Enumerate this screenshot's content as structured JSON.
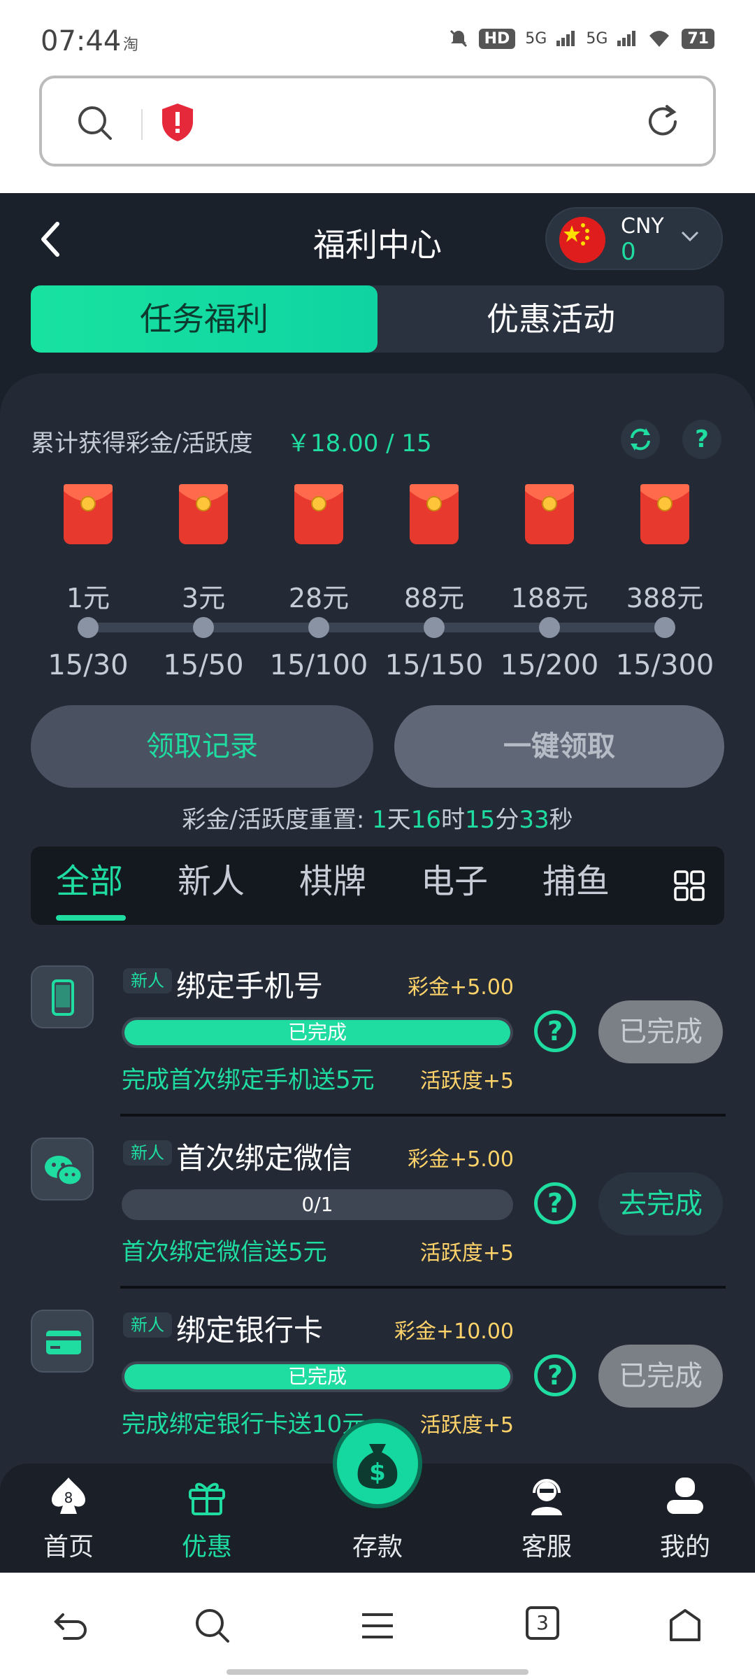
{
  "status_bar": {
    "time": "07:44",
    "app_indicator": "淘",
    "signal_1": "5G",
    "signal_2": "5G",
    "battery": "71",
    "hd": "HD"
  },
  "browser": {
    "search_icon": "search-icon",
    "security_icon": "shield-icon",
    "reload_icon": "reload-icon"
  },
  "header": {
    "title": "福利中心",
    "back_icon": "chevron-left-icon",
    "currency_code": "CNY",
    "balance": "0"
  },
  "top_tabs": [
    {
      "label": "任务福利",
      "active": true
    },
    {
      "label": "优惠活动",
      "active": false
    }
  ],
  "summary": {
    "label": "累计获得彩金/活跃度",
    "value": "￥18.00 / 15"
  },
  "milestones": [
    {
      "amount": "1元",
      "progress": "15/30"
    },
    {
      "amount": "3元",
      "progress": "15/50"
    },
    {
      "amount": "28元",
      "progress": "15/100"
    },
    {
      "amount": "88元",
      "progress": "15/150"
    },
    {
      "amount": "188元",
      "progress": "15/200"
    },
    {
      "amount": "388元",
      "progress": "15/300"
    }
  ],
  "actions": {
    "record": "领取记录",
    "claim_all": "一键领取"
  },
  "reset": {
    "label": "彩金/活跃度重置: ",
    "days": "1",
    "days_unit": "天",
    "hours": "16",
    "hours_unit": "时",
    "minutes": "15",
    "minutes_unit": "分",
    "seconds": "33",
    "seconds_unit": "秒"
  },
  "categories": [
    {
      "label": "全部",
      "active": true
    },
    {
      "label": "新人",
      "active": false
    },
    {
      "label": "棋牌",
      "active": false
    },
    {
      "label": "电子",
      "active": false
    },
    {
      "label": "捕鱼",
      "active": false
    }
  ],
  "tasks": [
    {
      "tag": "新人",
      "title": "绑定手机号",
      "reward": "彩金+5.00",
      "progress_text": "已完成",
      "progress": 1.0,
      "desc": "完成首次绑定手机送5元",
      "activity": "活跃度+5",
      "button": "已完成",
      "icon": "phone-icon"
    },
    {
      "tag": "新人",
      "title": "首次绑定微信",
      "reward": "彩金+5.00",
      "progress_text": "0/1",
      "progress": 0.0,
      "desc": "首次绑定微信送5元",
      "activity": "活跃度+5",
      "button": "去完成",
      "icon": "wechat-icon"
    },
    {
      "tag": "新人",
      "title": "绑定银行卡",
      "reward": "彩金+10.00",
      "progress_text": "已完成",
      "progress": 1.0,
      "desc": "完成绑定银行卡送10元",
      "activity": "活跃度+5",
      "button": "已完成",
      "icon": "bank-card-icon"
    }
  ],
  "bottom_nav": [
    {
      "label": "首页",
      "icon": "home-spade-icon",
      "active": false
    },
    {
      "label": "优惠",
      "icon": "gift-icon",
      "active": true
    },
    {
      "label": "存款",
      "icon": "money-bag-icon",
      "active": false
    },
    {
      "label": "客服",
      "icon": "support-agent-icon",
      "active": false
    },
    {
      "label": "我的",
      "icon": "user-icon",
      "active": false
    }
  ],
  "system_nav": {
    "tabs_count": "3"
  },
  "colors": {
    "accent": "#1fdca0",
    "background": "#1b212b",
    "panel": "#232a35",
    "gold": "#ffd36a"
  }
}
